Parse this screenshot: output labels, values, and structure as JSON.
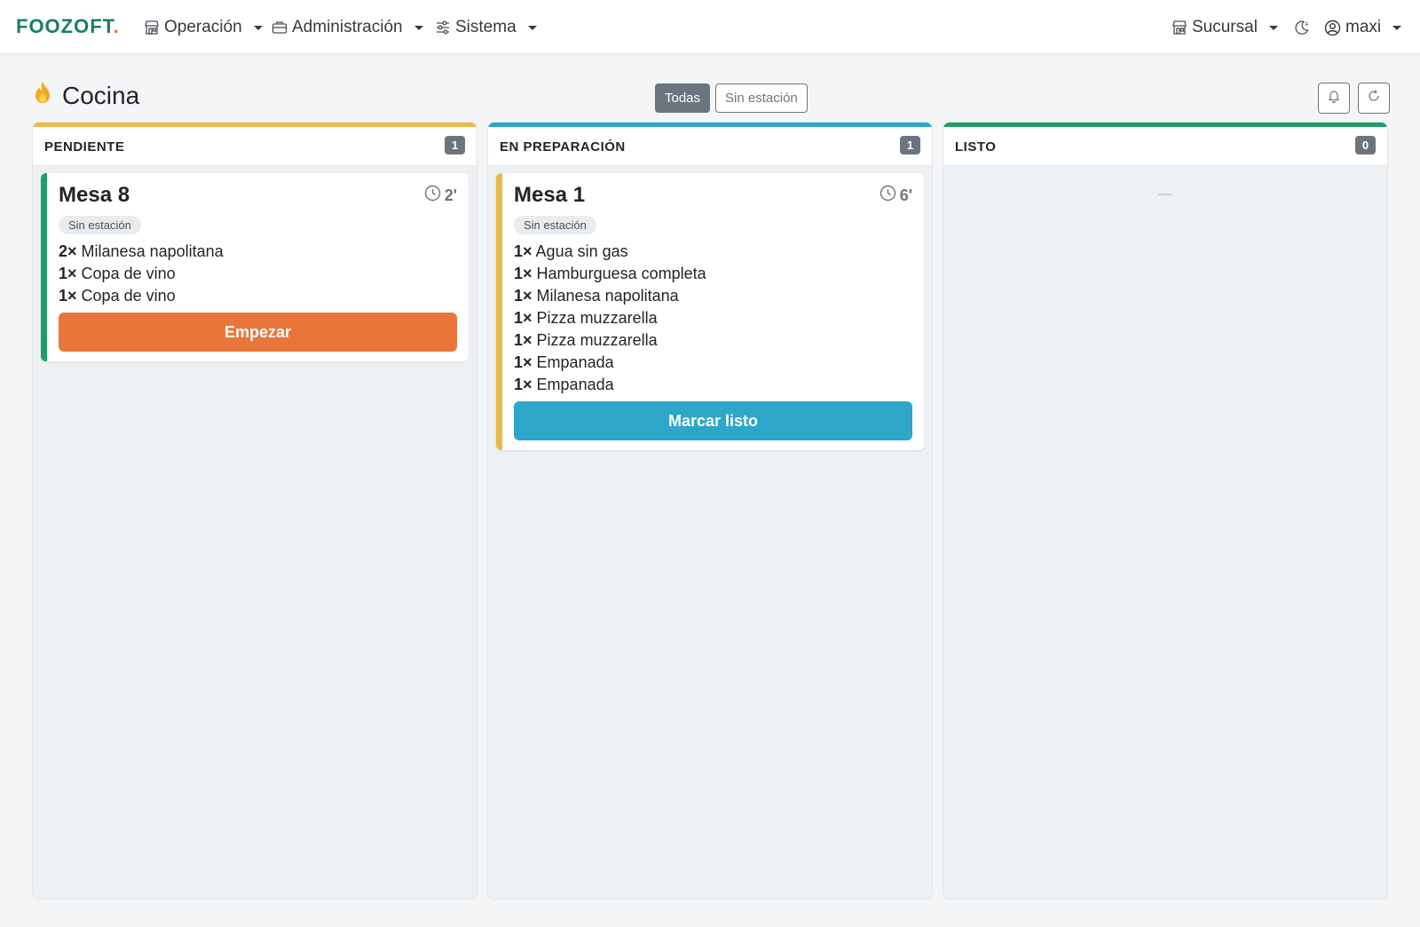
{
  "navbar": {
    "brand": "FOOZOFT",
    "brand_dot": ".",
    "menu": [
      {
        "label": "Operación",
        "icon": "store-icon"
      },
      {
        "label": "Administración",
        "icon": "briefcase-icon"
      },
      {
        "label": "Sistema",
        "icon": "sliders-icon"
      }
    ],
    "branch_label": "Sucursal",
    "theme_icon": "moon-icon",
    "user_label": "maxi"
  },
  "page": {
    "title": "Cocina",
    "title_icon": "fire-icon",
    "filters": [
      {
        "label": "Todas",
        "active": true
      },
      {
        "label": "Sin estación",
        "active": false
      }
    ],
    "bell_icon": "bell-icon",
    "refresh_icon": "refresh-icon"
  },
  "columns": [
    {
      "title": "PENDIENTE",
      "count": "1",
      "color": "#e9b949",
      "empty": "",
      "card": {
        "title": "Mesa 8",
        "time": "2'",
        "station": "Sin estación",
        "accent": "#1f9d6b",
        "items": [
          {
            "qty": "2×",
            "name": "Milanesa napolitana"
          },
          {
            "qty": "1×",
            "name": "Copa de vino"
          },
          {
            "qty": "1×",
            "name": "Copa de vino"
          }
        ],
        "action": "Empezar",
        "action_color": "#e8763a"
      }
    },
    {
      "title": "EN PREPARACIÓN",
      "count": "1",
      "color": "#2ea6c9",
      "empty": "",
      "card": {
        "title": "Mesa 1",
        "time": "6'",
        "station": "Sin estación",
        "accent": "#e9b949",
        "items": [
          {
            "qty": "1×",
            "name": "Agua sin gas"
          },
          {
            "qty": "1×",
            "name": "Hamburguesa completa"
          },
          {
            "qty": "1×",
            "name": "Milanesa napolitana"
          },
          {
            "qty": "1×",
            "name": "Pizza muzzarella"
          },
          {
            "qty": "1×",
            "name": "Pizza muzzarella"
          },
          {
            "qty": "1×",
            "name": "Empanada"
          },
          {
            "qty": "1×",
            "name": "Empanada"
          }
        ],
        "action": "Marcar listo",
        "action_color": "#2ea6c9"
      }
    },
    {
      "title": "LISTO",
      "count": "0",
      "color": "#1f9d6b",
      "empty": "—"
    }
  ]
}
